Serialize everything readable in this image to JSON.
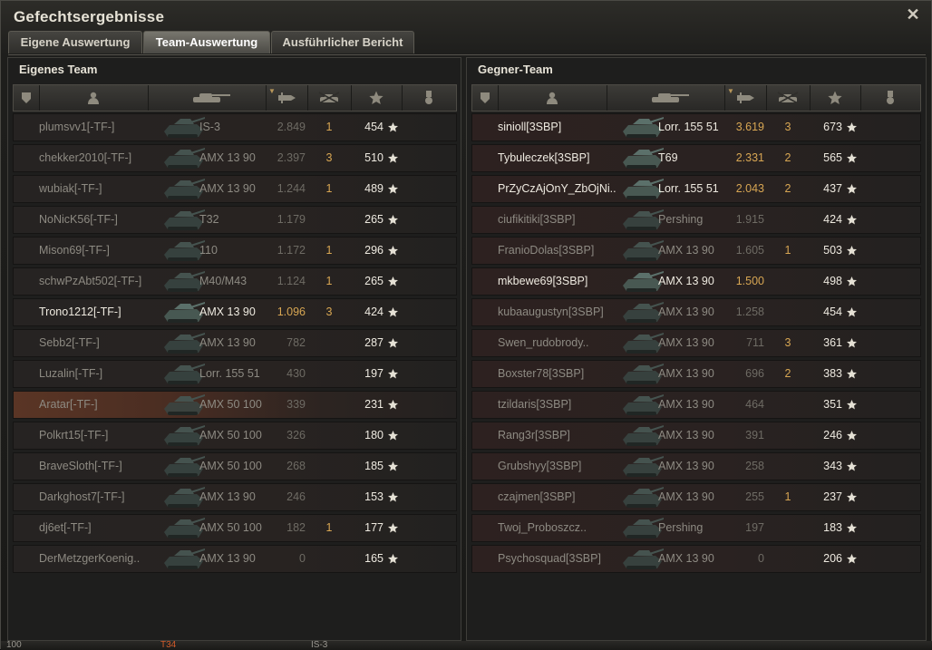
{
  "window": {
    "title": "Gefechtsergebnisse",
    "tabs": [
      "Eigene Auswertung",
      "Team-Auswertung",
      "Ausführlicher Bericht"
    ],
    "active_tab": "Team-Auswertung"
  },
  "left": {
    "title": "Eigenes Team",
    "rows": [
      {
        "player": "plumsvv1[-TF-]",
        "tank": "IS-3",
        "eff": "2.849",
        "kills": "1",
        "xp": "454",
        "alive": false
      },
      {
        "player": "chekker2010[-TF-]",
        "tank": "AMX 13 90",
        "eff": "2.397",
        "kills": "3",
        "xp": "510",
        "alive": false
      },
      {
        "player": "wubiak[-TF-]",
        "tank": "AMX 13 90",
        "eff": "1.244",
        "kills": "1",
        "xp": "489",
        "alive": false
      },
      {
        "player": "NoNicK56[-TF-]",
        "tank": "T32",
        "eff": "1.179",
        "kills": "",
        "xp": "265",
        "alive": false
      },
      {
        "player": "Mison69[-TF-]",
        "tank": "110",
        "eff": "1.172",
        "kills": "1",
        "xp": "296",
        "alive": false
      },
      {
        "player": "schwPzAbt502[-TF-]",
        "tank": "M40/M43",
        "eff": "1.124",
        "kills": "1",
        "xp": "265",
        "alive": false
      },
      {
        "player": "Trono1212[-TF-]",
        "tank": "AMX 13 90",
        "eff": "1.096",
        "kills": "3",
        "xp": "424",
        "alive": true
      },
      {
        "player": "Sebb2[-TF-]",
        "tank": "AMX 13 90",
        "eff": "782",
        "kills": "",
        "xp": "287",
        "alive": false
      },
      {
        "player": "Luzalin[-TF-]",
        "tank": "Lorr. 155 51",
        "eff": "430",
        "kills": "",
        "xp": "197",
        "alive": false
      },
      {
        "player": "Aratar[-TF-]",
        "tank": "AMX 50 100",
        "eff": "339",
        "kills": "",
        "xp": "231",
        "alive": false,
        "highlight": true
      },
      {
        "player": "Polkrt15[-TF-]",
        "tank": "AMX 50 100",
        "eff": "326",
        "kills": "",
        "xp": "180",
        "alive": false
      },
      {
        "player": "BraveSloth[-TF-]",
        "tank": "AMX 50 100",
        "eff": "268",
        "kills": "",
        "xp": "185",
        "alive": false
      },
      {
        "player": "Darkghost7[-TF-]",
        "tank": "AMX 13 90",
        "eff": "246",
        "kills": "",
        "xp": "153",
        "alive": false
      },
      {
        "player": "dj6et[-TF-]",
        "tank": "AMX 50 100",
        "eff": "182",
        "kills": "1",
        "xp": "177",
        "alive": false
      },
      {
        "player": "DerMetzgerKoenig..",
        "tank": "AMX 13 90",
        "eff": "0",
        "kills": "",
        "xp": "165",
        "alive": false
      }
    ]
  },
  "right": {
    "title": "Gegner-Team",
    "rows": [
      {
        "player": "sinioll[3SBP]",
        "tank": "Lorr. 155 51",
        "eff": "3.619",
        "kills": "3",
        "xp": "673",
        "alive": true
      },
      {
        "player": "Tybuleczek[3SBP]",
        "tank": "T69",
        "eff": "2.331",
        "kills": "2",
        "xp": "565",
        "alive": true
      },
      {
        "player": "PrZyCzAjOnY_ZbOjNi..",
        "tank": "Lorr. 155 51",
        "eff": "2.043",
        "kills": "2",
        "xp": "437",
        "alive": true
      },
      {
        "player": "ciufikitiki[3SBP]",
        "tank": "Pershing",
        "eff": "1.915",
        "kills": "",
        "xp": "424",
        "alive": false
      },
      {
        "player": "FranioDolas[3SBP]",
        "tank": "AMX 13 90",
        "eff": "1.605",
        "kills": "1",
        "xp": "503",
        "alive": false
      },
      {
        "player": "mkbewe69[3SBP]",
        "tank": "AMX 13 90",
        "eff": "1.500",
        "kills": "",
        "xp": "498",
        "alive": true
      },
      {
        "player": "kubaaugustyn[3SBP]",
        "tank": "AMX 13 90",
        "eff": "1.258",
        "kills": "",
        "xp": "454",
        "alive": false
      },
      {
        "player": "Swen_rudobrody..",
        "tank": "AMX 13 90",
        "eff": "711",
        "kills": "3",
        "xp": "361",
        "alive": false
      },
      {
        "player": "Boxster78[3SBP]",
        "tank": "AMX 13 90",
        "eff": "696",
        "kills": "2",
        "xp": "383",
        "alive": false
      },
      {
        "player": "tzildaris[3SBP]",
        "tank": "AMX 13 90",
        "eff": "464",
        "kills": "",
        "xp": "351",
        "alive": false
      },
      {
        "player": "Rang3r[3SBP]",
        "tank": "AMX 13 90",
        "eff": "391",
        "kills": "",
        "xp": "246",
        "alive": false
      },
      {
        "player": "Grubshyy[3SBP]",
        "tank": "AMX 13 90",
        "eff": "258",
        "kills": "",
        "xp": "343",
        "alive": false
      },
      {
        "player": "czajmen[3SBP]",
        "tank": "AMX 13 90",
        "eff": "255",
        "kills": "1",
        "xp": "237",
        "alive": false
      },
      {
        "player": "Twoj_Proboszcz..",
        "tank": "Pershing",
        "eff": "197",
        "kills": "",
        "xp": "183",
        "alive": false
      },
      {
        "player": "Psychosquad[3SBP]",
        "tank": "AMX 13 90",
        "eff": "0",
        "kills": "",
        "xp": "206",
        "alive": false
      }
    ]
  },
  "bottom_strip": {
    "texts": [
      "100",
      "T34",
      "IS-3"
    ]
  },
  "colors": {
    "gold": "#d7a653",
    "dim_text": "#8d8a82",
    "bright_text": "#eeeae0",
    "highlight_row": "#5a3525"
  }
}
